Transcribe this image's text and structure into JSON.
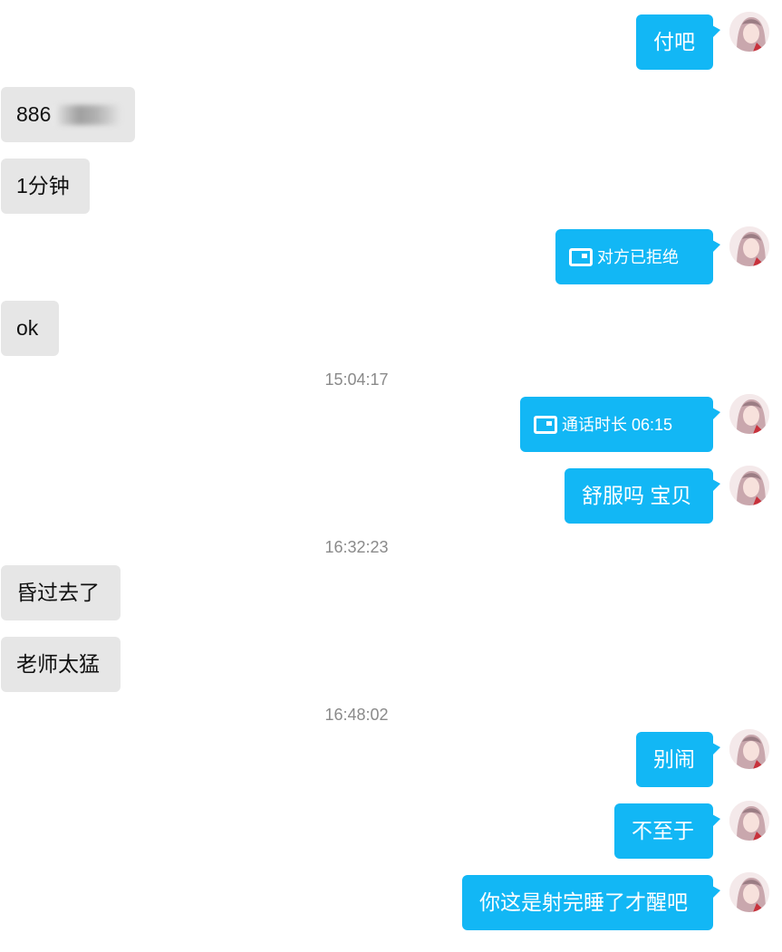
{
  "colors": {
    "outgoing_bubble": "#12b7f5",
    "incoming_bubble": "#e6e6e6",
    "timestamp": "#8a8a8a"
  },
  "icons": {
    "avatar": "avatar-girl-icon",
    "call": "video-camera-icon"
  },
  "messages": [
    {
      "side": "out",
      "text": "付吧"
    },
    {
      "side": "in",
      "text": "886",
      "redacted": true
    },
    {
      "side": "in",
      "text": "1分钟"
    },
    {
      "side": "out",
      "type": "call",
      "text": "对方已拒绝"
    },
    {
      "side": "in",
      "text": "ok"
    },
    {
      "type": "time",
      "text": "15:04:17"
    },
    {
      "side": "out",
      "type": "call",
      "text": "通话时长 06:15"
    },
    {
      "side": "out",
      "text": "舒服吗 宝贝"
    },
    {
      "type": "time",
      "text": "16:32:23"
    },
    {
      "side": "in",
      "text": "昏过去了"
    },
    {
      "side": "in",
      "text": "老师太猛"
    },
    {
      "type": "time",
      "text": "16:48:02"
    },
    {
      "side": "out",
      "text": "别闹"
    },
    {
      "side": "out",
      "text": "不至于"
    },
    {
      "side": "out",
      "text": "你这是射完睡了才醒吧"
    }
  ]
}
